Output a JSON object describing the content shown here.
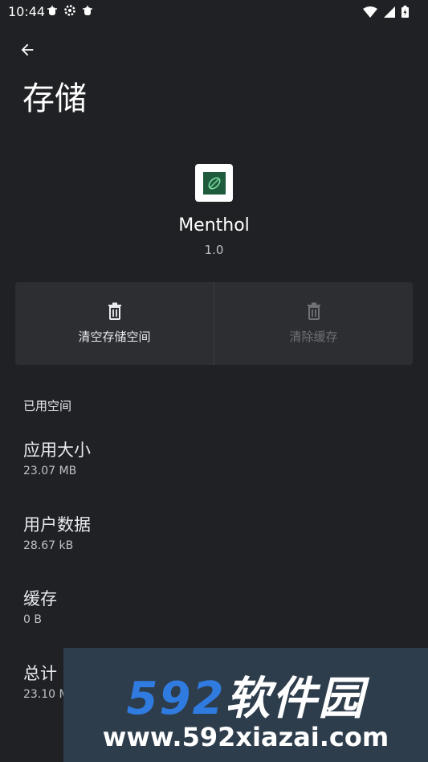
{
  "status_bar": {
    "time": "10:44",
    "left_icons": [
      "bug-icon",
      "gear-icon",
      "bug-icon"
    ],
    "right_icons": [
      "wifi-icon",
      "signal-icon",
      "battery-icon"
    ]
  },
  "header": {
    "title": "存储"
  },
  "app": {
    "name": "Menthol",
    "version": "1.0"
  },
  "actions": [
    {
      "label": "清空存储空间",
      "enabled": true
    },
    {
      "label": "清除缓存",
      "enabled": false
    }
  ],
  "section": {
    "header": "已用空间",
    "items": [
      {
        "title": "应用大小",
        "value": "23.07 MB"
      },
      {
        "title": "用户数据",
        "value": "28.67 kB"
      },
      {
        "title": "缓存",
        "value": "0 B"
      },
      {
        "title": "总计",
        "value": "23.10 MB"
      }
    ]
  },
  "watermark": {
    "brand_num": "592",
    "brand_text": "软件园",
    "url": "www.592xiazai.com"
  }
}
